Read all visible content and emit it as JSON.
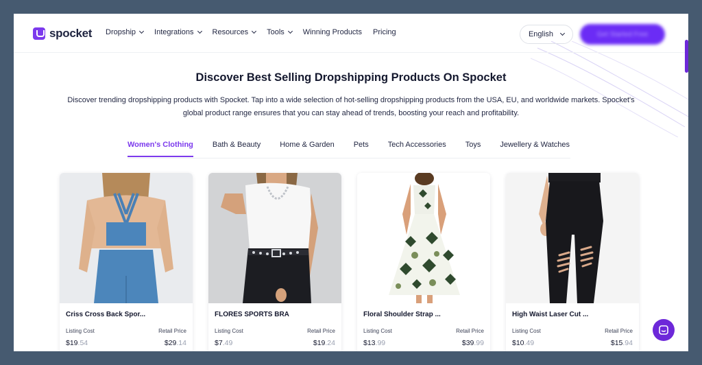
{
  "brand": {
    "name": "spocket"
  },
  "nav": {
    "items": [
      {
        "label": "Dropship",
        "dropdown": true
      },
      {
        "label": "Integrations",
        "dropdown": true
      },
      {
        "label": "Resources",
        "dropdown": true
      },
      {
        "label": "Tools",
        "dropdown": true
      },
      {
        "label": "Winning Products",
        "dropdown": false
      },
      {
        "label": "Pricing",
        "dropdown": false
      }
    ],
    "language": "English",
    "cta_label": "Get Started Free"
  },
  "hero": {
    "title": "Discover Best Selling Dropshipping Products On Spocket",
    "description": "Discover trending dropshipping products with Spocket. Tap into a wide selection of hot-selling dropshipping products from the USA, EU, and worldwide markets. Spocket's global product range ensures that you can stay ahead of trends, boosting your reach and profitability."
  },
  "tabs": [
    {
      "label": "Women's Clothing",
      "active": true
    },
    {
      "label": "Bath & Beauty",
      "active": false
    },
    {
      "label": "Home & Garden",
      "active": false
    },
    {
      "label": "Pets",
      "active": false
    },
    {
      "label": "Tech Accessories",
      "active": false
    },
    {
      "label": "Toys",
      "active": false
    },
    {
      "label": "Jewellery & Watches",
      "active": false
    }
  ],
  "products": [
    {
      "name": "Criss Cross Back Spor...",
      "listing_label": "Listing Cost",
      "listing_dollars": "$19",
      "listing_cents": ".54",
      "retail_label": "Retail Price",
      "retail_dollars": "$29",
      "retail_cents": ".14",
      "image": "blue-sports-top-photo"
    },
    {
      "name": "FLORES SPORTS BRA",
      "listing_label": "Listing Cost",
      "listing_dollars": "$7",
      "listing_cents": ".49",
      "retail_label": "Retail Price",
      "retail_dollars": "$19",
      "retail_cents": ".24",
      "image": "white-bodysuit-photo"
    },
    {
      "name": "Floral Shoulder Strap ...",
      "listing_label": "Listing Cost",
      "listing_dollars": "$13",
      "listing_cents": ".99",
      "retail_label": "Retail Price",
      "retail_dollars": "$39",
      "retail_cents": ".99",
      "image": "floral-dress-photo"
    },
    {
      "name": "High Waist Laser Cut ...",
      "listing_label": "Listing Cost",
      "listing_dollars": "$10",
      "listing_cents": ".49",
      "retail_label": "Retail Price",
      "retail_dollars": "$15",
      "retail_cents": ".94",
      "image": "black-leggings-photo"
    }
  ],
  "colors": {
    "accent": "#7c3aed",
    "frame": "#465a70",
    "text": "#14182e"
  },
  "icons": {
    "logo": "spocket-logo-icon",
    "dropdown": "chevron-down-icon",
    "chat": "chat-bubble-icon"
  }
}
